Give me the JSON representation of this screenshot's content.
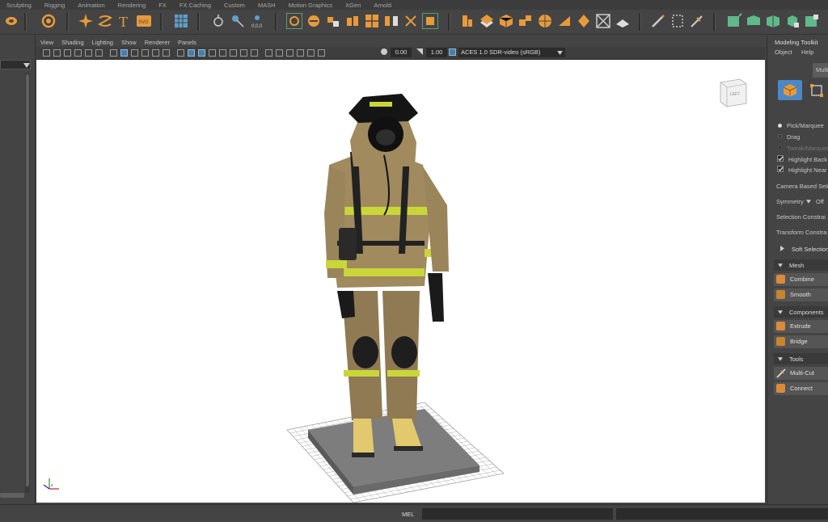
{
  "shelf_tabs": [
    "Sculpting",
    "Rigging",
    "Animation",
    "Rendering",
    "FX",
    "FX Caching",
    "Custom",
    "MASH",
    "Motion Graphics",
    "XGen",
    "Arnold"
  ],
  "viewport": {
    "menu": [
      "View",
      "Shading",
      "Lighting",
      "Show",
      "Renderer",
      "Panels"
    ],
    "exposure_value": "0.00",
    "gamma_value": "1.00",
    "color_space": "ACES 1.0 SDR-video (sRGB)",
    "view_cube_label": "LEFT"
  },
  "modeling_toolkit": {
    "title": "Modeling Toolkit",
    "menu": [
      "Object",
      "Help"
    ],
    "mode_tab": "Multi",
    "pick_marquee": "Pick/Marquee",
    "drag": "Drag",
    "tweak_marquee": "Tweak/Marquee",
    "highlight_back": "Highlight Back",
    "highlight_nearest": "Highlight Near",
    "camera_based": "Camera Based Sele",
    "symmetry_label": "Symmetry",
    "symmetry_value": "Off",
    "selection_constraint": "Selection Constrai",
    "transform_constraint": "Transform Constra",
    "soft_selection": "Soft Selection",
    "sections": {
      "mesh": "Mesh",
      "components": "Components",
      "tools": "Tools"
    },
    "buttons": {
      "combine": "Combine",
      "smooth": "Smooth",
      "extrude": "Extrude",
      "bridge": "Bridge",
      "multi_cut": "Multi-Cut",
      "connect": "Connect"
    }
  },
  "command_line": {
    "label": "MEL"
  },
  "colors": {
    "accent_orange": "#e89a3a",
    "accent_green": "#5fb98a",
    "viewport_bg": "#ffffff"
  },
  "icons": [
    "gear-icon",
    "sparkle-icon",
    "text-icon",
    "svg-icon",
    "grid-icon",
    "magnet-icon",
    "cube-icon",
    "sphere-icon",
    "pencil-icon",
    "lasso-icon"
  ]
}
